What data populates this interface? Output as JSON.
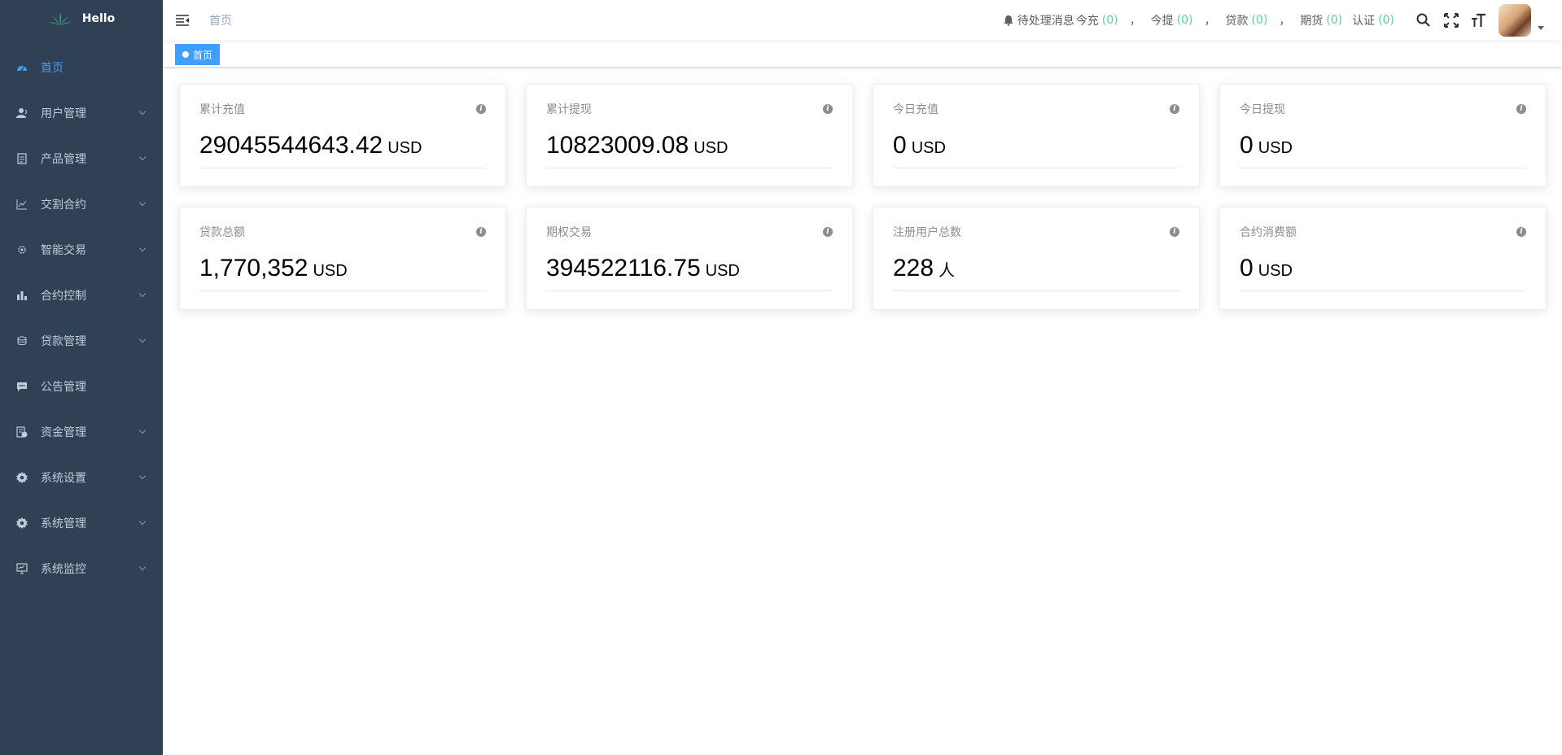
{
  "app": {
    "logo_text": "Hello"
  },
  "sidebar": {
    "items": [
      {
        "label": "首页",
        "icon": "dashboard-icon",
        "active": true,
        "expandable": false
      },
      {
        "label": "用户管理",
        "icon": "user-icon",
        "expandable": true
      },
      {
        "label": "产品管理",
        "icon": "document-icon",
        "expandable": true
      },
      {
        "label": "交割合约",
        "icon": "trend-chart-icon",
        "expandable": true
      },
      {
        "label": "智能交易",
        "icon": "gear-small-icon",
        "expandable": true
      },
      {
        "label": "合约控制",
        "icon": "bar-chart-icon",
        "expandable": true
      },
      {
        "label": "贷款管理",
        "icon": "coins-icon",
        "expandable": true
      },
      {
        "label": "公告管理",
        "icon": "message-icon",
        "expandable": false
      },
      {
        "label": "资金管理",
        "icon": "money-icon",
        "expandable": true
      },
      {
        "label": "系统设置",
        "icon": "settings-icon",
        "expandable": true
      },
      {
        "label": "系统管理",
        "icon": "system-icon",
        "expandable": true
      },
      {
        "label": "系统监控",
        "icon": "monitor-icon",
        "expandable": true
      }
    ]
  },
  "header": {
    "breadcrumb": "首页",
    "notice": {
      "label": "待处理消息",
      "items": [
        {
          "label": "今充",
          "count": "(0)"
        },
        {
          "label": "今提",
          "count": "(0)"
        },
        {
          "label": "贷款",
          "count": "(0)"
        },
        {
          "label": "期货",
          "count": "(0)"
        },
        {
          "label": "认证",
          "count": "(0)"
        }
      ],
      "separator": "，"
    }
  },
  "tags": {
    "active": "首页"
  },
  "cards": [
    {
      "title": "累计充值",
      "value": "29045544643.42",
      "unit": "USD"
    },
    {
      "title": "累计提现",
      "value": "10823009.08",
      "unit": "USD"
    },
    {
      "title": "今日充值",
      "value": "0",
      "unit": "USD"
    },
    {
      "title": "今日提现",
      "value": "0",
      "unit": "USD"
    },
    {
      "title": "贷款总额",
      "value": "1,770,352",
      "unit": "USD"
    },
    {
      "title": "期权交易",
      "value": "394522116.75",
      "unit": "USD"
    },
    {
      "title": "注册用户总数",
      "value": "228",
      "unit": "人"
    },
    {
      "title": "合约消费额",
      "value": "0",
      "unit": "USD"
    }
  ],
  "colors": {
    "sidebar_bg": "#304156",
    "sidebar_text": "#bfcbd9",
    "accent": "#409eff",
    "count_green": "#5cd196"
  }
}
